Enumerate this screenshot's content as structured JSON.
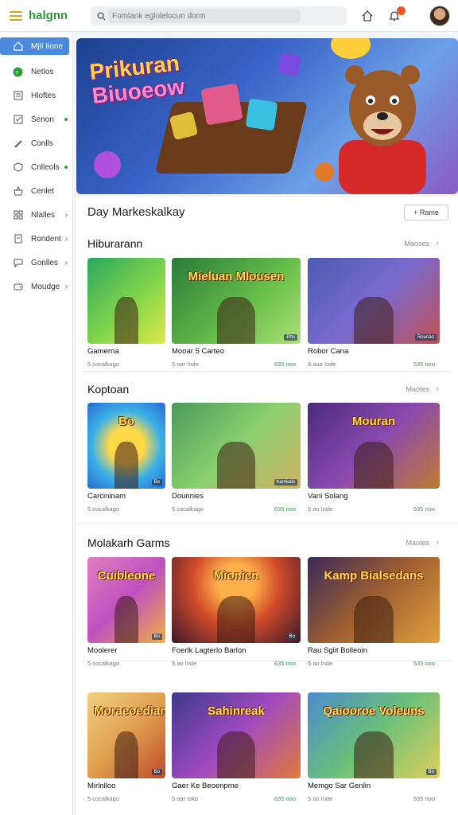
{
  "app": {
    "name": "halgnn"
  },
  "search": {
    "placeholder": "Fomlank eglolelocun dorm"
  },
  "sidebar": {
    "items": [
      {
        "label": "MjIi Iione",
        "icon": "home-icon",
        "active": true
      },
      {
        "label": "Netlos",
        "icon": "circle-r-icon"
      },
      {
        "label": "Hloftes",
        "icon": "list-icon"
      },
      {
        "label": "Senon",
        "icon": "checkbox-icon",
        "dot": true
      },
      {
        "label": "Conlls",
        "icon": "pen-icon"
      },
      {
        "label": "Cnlleols",
        "icon": "shield-icon",
        "dot": true
      },
      {
        "label": "Cenlet",
        "icon": "basket-icon"
      },
      {
        "label": "Nlalles",
        "icon": "grid-icon",
        "arrow": "›"
      },
      {
        "label": "Rondent",
        "icon": "doc-icon",
        "arrow": "›"
      },
      {
        "label": "Gonlles",
        "icon": "chat-icon",
        "arrow": "›"
      },
      {
        "label": "Moudge",
        "icon": "games-icon",
        "arrow": "›"
      }
    ]
  },
  "hero": {
    "title_line1": "Prikuran",
    "title_line2": "Biuoeow"
  },
  "day": {
    "title": "Day Markeskalkay",
    "frame_button": "+ Rame"
  },
  "sections": [
    {
      "title": "Hiburarann",
      "more": "Maoses",
      "cards": [
        {
          "title": "Gamerna",
          "sub": "5 cocalkago",
          "price": "",
          "badge": ""
        },
        {
          "title": "Mooar 5 Carteo",
          "sub": "5 oar Inde",
          "price": "635 noo",
          "badge": "Pho"
        },
        {
          "title": "Robor Cana",
          "sub": "9 aua Iode",
          "price": "535 noo",
          "badge": "Rounao"
        }
      ]
    },
    {
      "title": "Koptoan",
      "more": "Maotes",
      "cards": [
        {
          "title": "Carcininam",
          "sub": "5 cocalkago",
          "price": "",
          "badge": "Bo"
        },
        {
          "title": "Dounnies",
          "sub": "5 cocalkago",
          "price": "635 noo",
          "badge": "Kamkalo"
        },
        {
          "title": "Vani Solang",
          "sub": "5 ao Inde",
          "price": "535 noo",
          "badge": ""
        }
      ]
    },
    {
      "title": "Molakarh Garms",
      "more": "Maotes",
      "cards": [
        {
          "title": "Moolerer",
          "sub": "5 cocalkago",
          "price": "",
          "badge": "Bo"
        },
        {
          "title": "Foerlk Lagterlo Barlon",
          "sub": "5 ao Inde",
          "price": "635 noo",
          "badge": "Bo"
        },
        {
          "title": "Rau Sglit Bolleoin",
          "sub": "5 ao Inde",
          "price": "535 noo",
          "badge": ""
        }
      ]
    },
    {
      "title": "",
      "more": "",
      "cards": [
        {
          "title": "Mirlnlloo",
          "sub": "5 cocalkago",
          "price": "",
          "badge": "Bo"
        },
        {
          "title": "Gaer Ke Beoenpme",
          "sub": "5 aar Ioko",
          "price": "635 noo",
          "badge": ""
        },
        {
          "title": "Memgo Sar Genlin",
          "sub": "5 ao Inde",
          "price": "535 noo",
          "badge": "Bo"
        }
      ]
    }
  ],
  "thumb_texts": {
    "s1c2": "Mieluan Mlousen",
    "s2c1": "Bo",
    "s2c3": "Mouran",
    "s3c1": "Cuibleone",
    "s3c2": "Mionicn",
    "s3c3": "Kamp Bialsedans",
    "s4c1": "Moraeoedian",
    "s4c2": "Sahinreak",
    "s4c3": "Qaiooroe Voleuns"
  },
  "colors": {
    "accent": "#4a89dc",
    "logo": "#2d9a3c",
    "price": "#3a9a4a"
  }
}
